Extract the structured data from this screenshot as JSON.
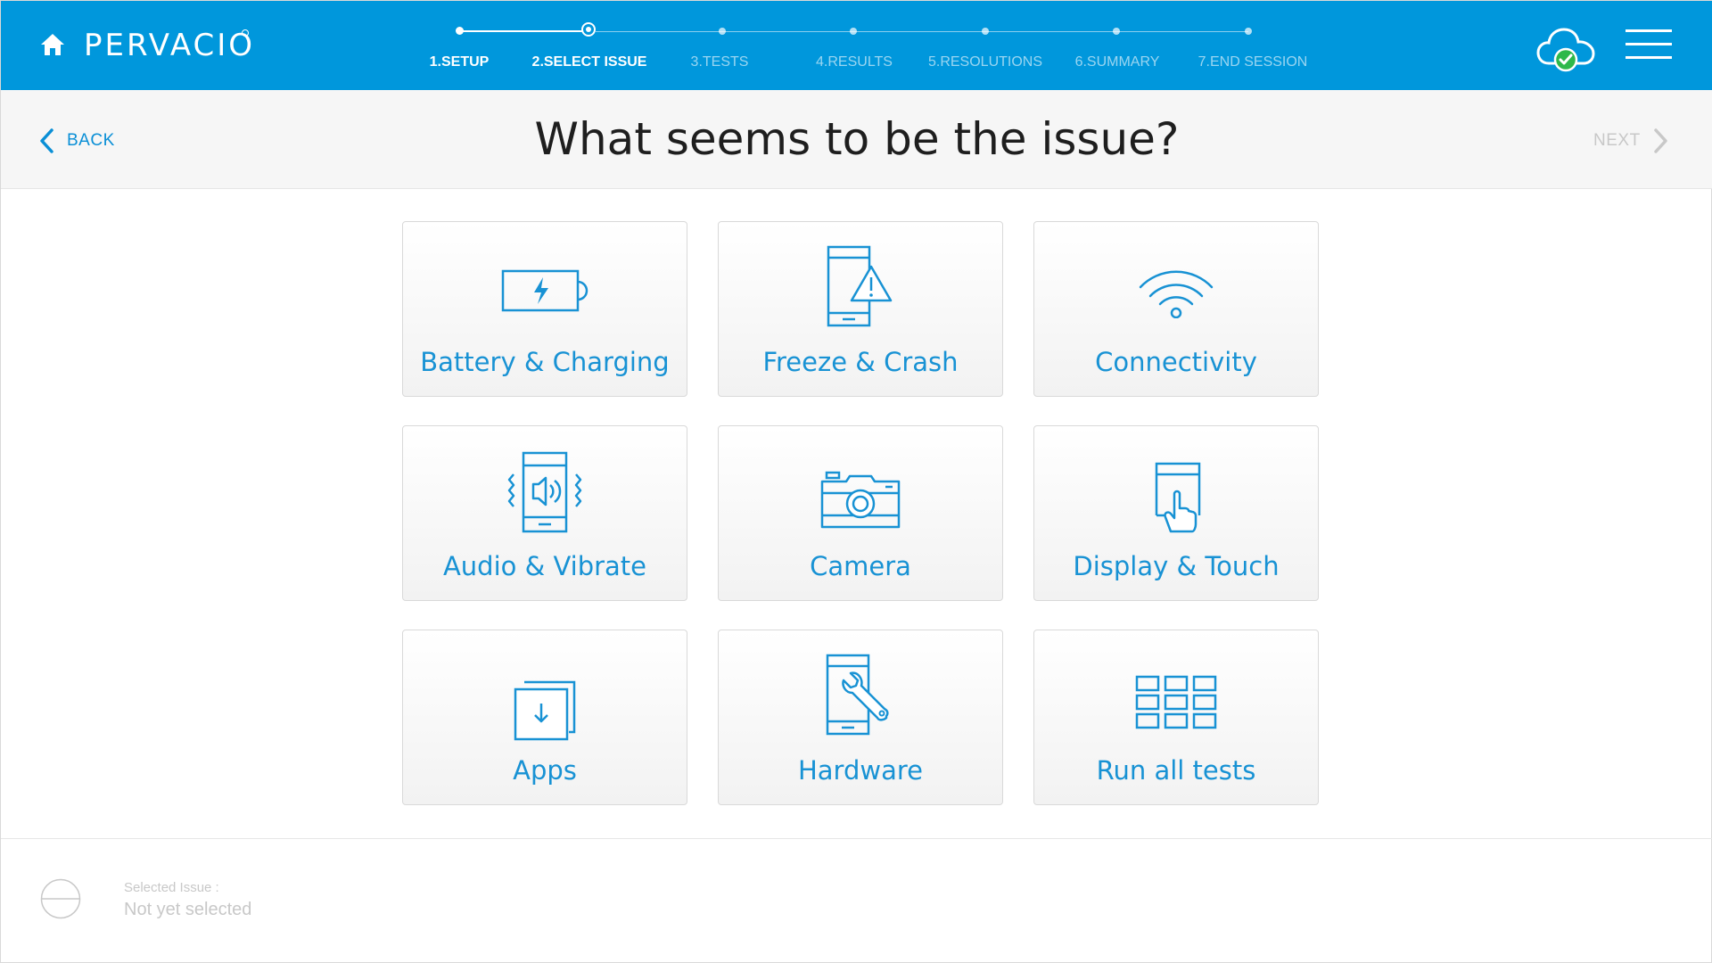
{
  "header": {
    "brand": "PERVACIO",
    "steps": [
      {
        "label": "1.SETUP",
        "state": "done"
      },
      {
        "label": "2.SELECT ISSUE",
        "state": "current"
      },
      {
        "label": "3.TESTS",
        "state": "future"
      },
      {
        "label": "4.RESULTS",
        "state": "future"
      },
      {
        "label": "5.RESOLUTIONS",
        "state": "future"
      },
      {
        "label": "6.SUMMARY",
        "state": "future"
      },
      {
        "label": "7.END SESSION",
        "state": "future"
      }
    ],
    "cloud_status": "connected"
  },
  "subheader": {
    "back_label": "BACK",
    "title": "What seems to be the issue?",
    "next_label": "NEXT"
  },
  "issues": [
    {
      "label": "Battery & Charging",
      "icon": "battery-charging-icon"
    },
    {
      "label": "Freeze & Crash",
      "icon": "phone-warning-icon"
    },
    {
      "label": "Connectivity",
      "icon": "wifi-icon"
    },
    {
      "label": "Audio & Vibrate",
      "icon": "phone-speaker-vibrate-icon"
    },
    {
      "label": "Camera",
      "icon": "camera-icon"
    },
    {
      "label": "Display & Touch",
      "icon": "touch-display-icon"
    },
    {
      "label": "Apps",
      "icon": "apps-download-icon"
    },
    {
      "label": "Hardware",
      "icon": "phone-wrench-icon"
    },
    {
      "label": "Run all tests",
      "icon": "grid-tests-icon"
    }
  ],
  "footer": {
    "selected_caption": "Selected Issue :",
    "selected_value": "Not yet selected"
  },
  "colors": {
    "header_bg": "#0097dc",
    "accent": "#1892d4",
    "muted": "#c8c8c8",
    "cloud_check": "#2eb84a"
  }
}
